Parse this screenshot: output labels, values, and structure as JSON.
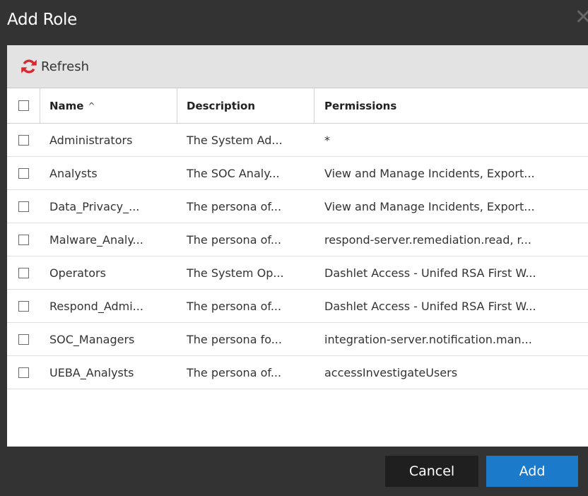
{
  "dialog": {
    "title": "Add Role",
    "close_label": "✕"
  },
  "toolbar": {
    "refresh_label": "Refresh"
  },
  "table": {
    "columns": {
      "name": "Name",
      "name_sort": "^",
      "description": "Description",
      "permissions": "Permissions"
    },
    "rows": [
      {
        "name": "Administrators",
        "description": "The System Ad...",
        "permissions": "*"
      },
      {
        "name": "Analysts",
        "description": "The SOC Analy...",
        "permissions": "View and Manage Incidents, Export..."
      },
      {
        "name": "Data_Privacy_...",
        "description": "The persona of...",
        "permissions": "View and Manage Incidents, Export..."
      },
      {
        "name": "Malware_Analy...",
        "description": "The persona of...",
        "permissions": "respond-server.remediation.read, r..."
      },
      {
        "name": "Operators",
        "description": "The System Op...",
        "permissions": "Dashlet Access - Unifed RSA First W..."
      },
      {
        "name": "Respond_Admi...",
        "description": "The persona of...",
        "permissions": "Dashlet Access - Unifed RSA First W..."
      },
      {
        "name": "SOC_Managers",
        "description": "The persona fo...",
        "permissions": "integration-server.notification.man..."
      },
      {
        "name": "UEBA_Analysts",
        "description": "The persona of...",
        "permissions": "accessInvestigateUsers"
      }
    ]
  },
  "footer": {
    "cancel_label": "Cancel",
    "add_label": "Add"
  },
  "colors": {
    "dialog_bg": "#333333",
    "toolbar_bg": "#e3e3e3",
    "add_button": "#1b7ac9",
    "cancel_button": "#1f1f1f",
    "refresh_icon": "#d9272e"
  },
  "icons": {
    "refresh": "refresh-icon",
    "sort": "sort-ascending-icon",
    "close": "close-icon"
  }
}
